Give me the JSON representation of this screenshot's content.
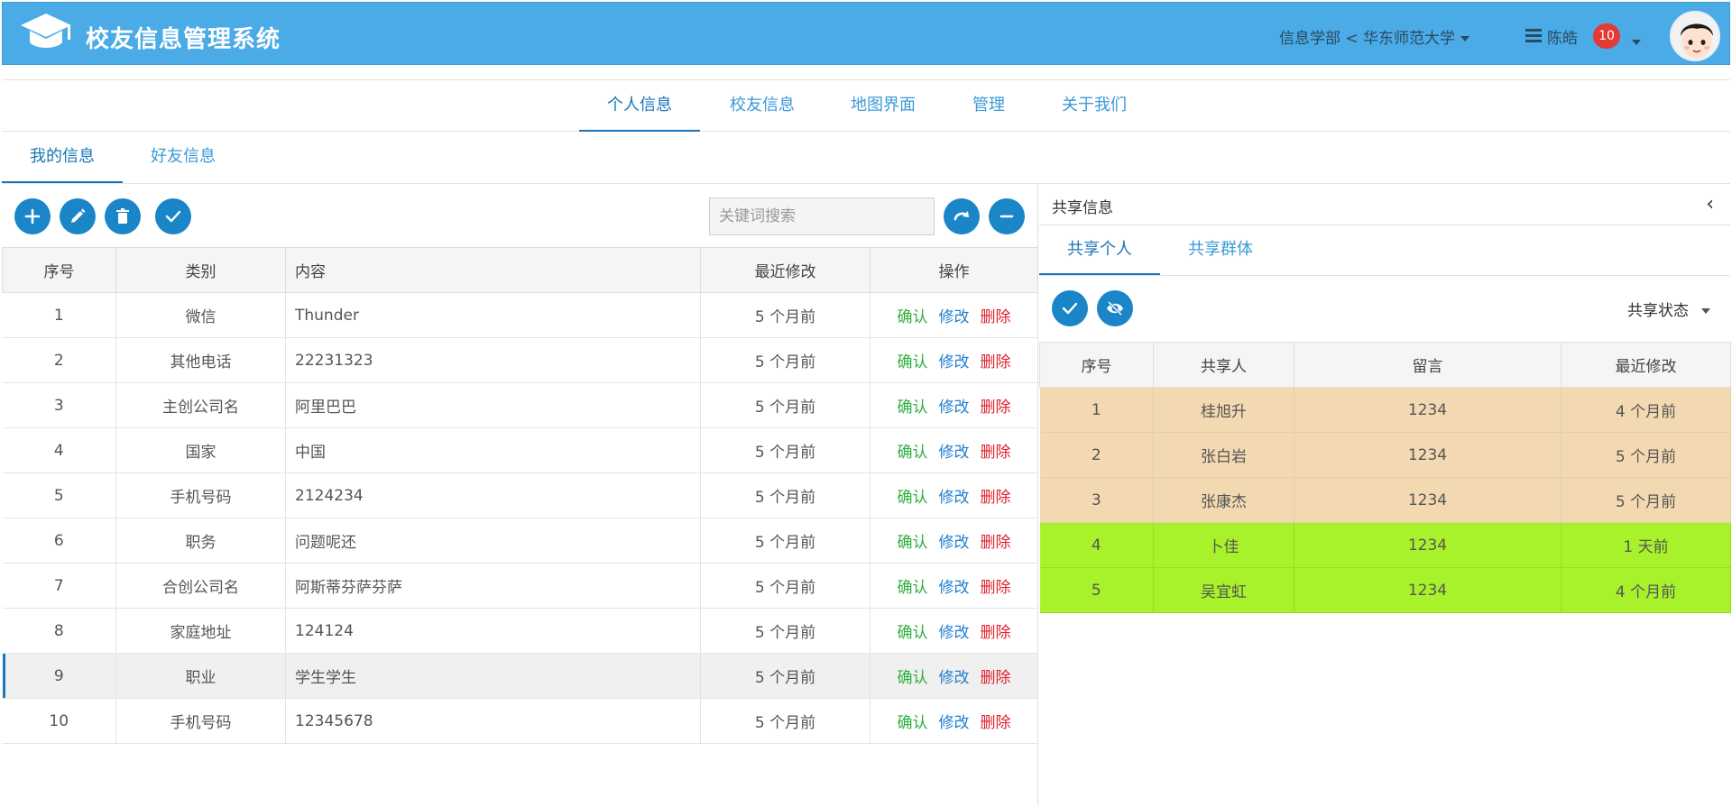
{
  "header": {
    "app_title": "校友信息管理系统",
    "department": "信息学部 < 华东师范大学",
    "user_name": "陈皓",
    "notification_count": "10",
    "brand_color": "#4aabe6"
  },
  "top_nav": [
    {
      "label": "个人信息",
      "active": true
    },
    {
      "label": "校友信息",
      "active": false
    },
    {
      "label": "地图界面",
      "active": false
    },
    {
      "label": "管理",
      "active": false
    },
    {
      "label": "关于我们",
      "active": false
    }
  ],
  "sub_tabs": [
    {
      "label": "我的信息",
      "active": true
    },
    {
      "label": "好友信息",
      "active": false
    }
  ],
  "toolbar": {
    "icons": [
      "plus-icon",
      "pencil-icon",
      "trash-icon",
      "check-icon",
      "redo-icon",
      "minus-icon"
    ],
    "search_placeholder": "关键词搜索"
  },
  "info_table": {
    "columns": [
      "序号",
      "类别",
      "内容",
      "最近修改",
      "操作"
    ],
    "actions": {
      "confirm": "确认",
      "edit": "修改",
      "delete": "删除"
    },
    "rows": [
      {
        "no": "1",
        "category": "微信",
        "content": "Thunder",
        "modified": "5 个月前"
      },
      {
        "no": "2",
        "category": "其他电话",
        "content": "22231323",
        "modified": "5 个月前"
      },
      {
        "no": "3",
        "category": "主创公司名",
        "content": "阿里巴巴",
        "modified": "5 个月前"
      },
      {
        "no": "4",
        "category": "国家",
        "content": "中国",
        "modified": "5 个月前"
      },
      {
        "no": "5",
        "category": "手机号码",
        "content": "2124234",
        "modified": "5 个月前"
      },
      {
        "no": "6",
        "category": "职务",
        "content": "问题呢还",
        "modified": "5 个月前"
      },
      {
        "no": "7",
        "category": "合创公司名",
        "content": "阿斯蒂芬萨芬萨",
        "modified": "5 个月前"
      },
      {
        "no": "8",
        "category": "家庭地址",
        "content": "124124",
        "modified": "5 个月前"
      },
      {
        "no": "9",
        "category": "职业",
        "content": "学生学生",
        "modified": "5 个月前"
      },
      {
        "no": "10",
        "category": "手机号码",
        "content": "12345678",
        "modified": "5 个月前"
      }
    ]
  },
  "share_panel": {
    "title": "共享信息",
    "tabs": [
      {
        "label": "共享个人",
        "active": true
      },
      {
        "label": "共享群体",
        "active": false
      }
    ],
    "status_label": "共享状态",
    "columns": [
      "序号",
      "共享人",
      "留言",
      "最近修改"
    ],
    "row_colors": {
      "peach": "#f3d9b1",
      "lime": "#a8f22b"
    },
    "rows": [
      {
        "no": "1",
        "person": "桂旭升",
        "message": "1234",
        "modified": "4 个月前",
        "color": "peach"
      },
      {
        "no": "2",
        "person": "张白岩",
        "message": "1234",
        "modified": "5 个月前",
        "color": "peach"
      },
      {
        "no": "3",
        "person": "张康杰",
        "message": "1234",
        "modified": "5 个月前",
        "color": "peach"
      },
      {
        "no": "4",
        "person": "卜佳",
        "message": "1234",
        "modified": "1 天前",
        "color": "lime"
      },
      {
        "no": "5",
        "person": "吴宜虹",
        "message": "1234",
        "modified": "4 个月前",
        "color": "lime"
      }
    ]
  }
}
